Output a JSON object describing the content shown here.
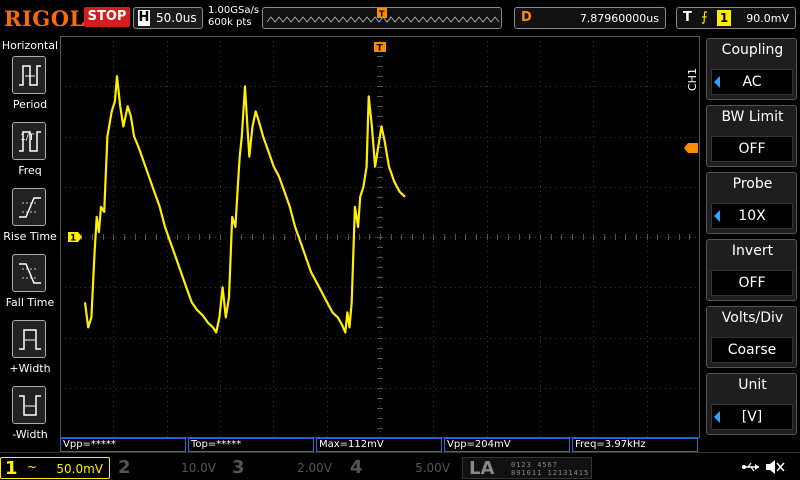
{
  "header": {
    "brand": "RIGOL",
    "run_state": "STOP",
    "horizontal_label": "H",
    "timebase": "50.0us",
    "sample_rate": "1.00GSa/s",
    "memory_depth": "600k pts",
    "delay_label": "D",
    "delay_value": "7.87960000us",
    "trigger_label": "T",
    "trigger_channel": "1",
    "trigger_level": "90.0mV"
  },
  "left_menu": {
    "title": "Horizontal",
    "items": [
      {
        "label": "Period",
        "icon": "period-icon"
      },
      {
        "label": "Freq",
        "icon": "freq-icon"
      },
      {
        "label": "Rise Time",
        "icon": "rise-time-icon"
      },
      {
        "label": "Fall Time",
        "icon": "fall-time-icon"
      },
      {
        "label": "+Width",
        "icon": "pos-width-icon"
      },
      {
        "label": "-Width",
        "icon": "neg-width-icon"
      }
    ]
  },
  "right_menu": {
    "channel_tab": "CH1",
    "items": [
      {
        "title": "Coupling",
        "value": "AC",
        "has_arrow": true
      },
      {
        "title": "BW Limit",
        "value": "OFF",
        "has_arrow": false
      },
      {
        "title": "Probe",
        "value": "10X",
        "has_arrow": true
      },
      {
        "title": "Invert",
        "value": "OFF",
        "has_arrow": false
      },
      {
        "title": "Volts/Div",
        "value": "Coarse",
        "has_arrow": false
      },
      {
        "title": "Unit",
        "value": "[V]",
        "has_arrow": true
      }
    ]
  },
  "measurements": [
    {
      "text": "Vpp=*****"
    },
    {
      "text": "Top=*****"
    },
    {
      "text": "Max=112mV"
    },
    {
      "text": "Vpp=204mV"
    },
    {
      "text": "Freq=3.97kHz"
    }
  ],
  "channels": [
    {
      "num": "1",
      "coupling": "~",
      "scale": "50.0mV",
      "active": true
    },
    {
      "num": "2",
      "coupling": "",
      "scale": "10.0V",
      "active": false
    },
    {
      "num": "3",
      "coupling": "",
      "scale": "2.00V",
      "active": false
    },
    {
      "num": "4",
      "coupling": "",
      "scale": "5.00V",
      "active": false
    }
  ],
  "la": {
    "label": "LA",
    "bits_row1": "0123 4567",
    "bits_row2": "891011 12131415"
  },
  "markers": {
    "trigger_pos": "T",
    "ch1_ground": "1"
  },
  "colors": {
    "ch1": "#ffee00",
    "trigger": "#ff8a00",
    "stop": "#d51d1d",
    "brand": "#ff6a00",
    "grid": "#3a3a3a",
    "menu_accent": "#2fa3ff"
  },
  "waveform": {
    "channel": "1",
    "samples": [
      [
        0.0,
        -1.3
      ],
      [
        0.06,
        -1.8
      ],
      [
        0.12,
        -1.6
      ],
      [
        0.18,
        -0.3
      ],
      [
        0.22,
        0.4
      ],
      [
        0.26,
        0.1
      ],
      [
        0.3,
        0.6
      ],
      [
        0.36,
        0.5
      ],
      [
        0.42,
        2.0
      ],
      [
        0.5,
        2.5
      ],
      [
        0.56,
        2.7
      ],
      [
        0.6,
        3.2
      ],
      [
        0.66,
        2.6
      ],
      [
        0.72,
        2.2
      ],
      [
        0.8,
        2.6
      ],
      [
        0.86,
        2.4
      ],
      [
        0.92,
        2.0
      ],
      [
        1.0,
        1.8
      ],
      [
        1.1,
        1.5
      ],
      [
        1.2,
        1.2
      ],
      [
        1.3,
        0.9
      ],
      [
        1.4,
        0.6
      ],
      [
        1.5,
        0.2
      ],
      [
        1.6,
        -0.1
      ],
      [
        1.7,
        -0.4
      ],
      [
        1.8,
        -0.7
      ],
      [
        1.9,
        -1.0
      ],
      [
        2.0,
        -1.3
      ],
      [
        2.1,
        -1.45
      ],
      [
        2.2,
        -1.55
      ],
      [
        2.3,
        -1.7
      ],
      [
        2.4,
        -1.8
      ],
      [
        2.46,
        -1.9
      ],
      [
        2.52,
        -1.6
      ],
      [
        2.58,
        -1.0
      ],
      [
        2.64,
        -1.6
      ],
      [
        2.7,
        -1.2
      ],
      [
        2.76,
        0.4
      ],
      [
        2.82,
        0.2
      ],
      [
        2.86,
        0.9
      ],
      [
        2.9,
        1.6
      ],
      [
        2.94,
        2.0
      ],
      [
        3.0,
        3.0
      ],
      [
        3.04,
        2.3
      ],
      [
        3.08,
        1.6
      ],
      [
        3.14,
        2.2
      ],
      [
        3.2,
        2.5
      ],
      [
        3.26,
        2.3
      ],
      [
        3.34,
        2.0
      ],
      [
        3.44,
        1.7
      ],
      [
        3.54,
        1.4
      ],
      [
        3.64,
        1.2
      ],
      [
        3.74,
        0.9
      ],
      [
        3.84,
        0.6
      ],
      [
        3.94,
        0.2
      ],
      [
        4.04,
        -0.1
      ],
      [
        4.14,
        -0.4
      ],
      [
        4.24,
        -0.7
      ],
      [
        4.34,
        -0.9
      ],
      [
        4.44,
        -1.1
      ],
      [
        4.54,
        -1.3
      ],
      [
        4.64,
        -1.5
      ],
      [
        4.74,
        -1.6
      ],
      [
        4.82,
        -1.75
      ],
      [
        4.88,
        -1.9
      ],
      [
        4.92,
        -1.5
      ],
      [
        4.96,
        -1.8
      ],
      [
        5.0,
        -1.3
      ],
      [
        5.06,
        0.6
      ],
      [
        5.12,
        0.2
      ],
      [
        5.16,
        0.8
      ],
      [
        5.22,
        1.0
      ],
      [
        5.28,
        1.4
      ],
      [
        5.32,
        2.8
      ],
      [
        5.38,
        2.2
      ],
      [
        5.44,
        1.4
      ],
      [
        5.5,
        1.8
      ],
      [
        5.56,
        2.2
      ],
      [
        5.62,
        1.9
      ],
      [
        5.7,
        1.4
      ],
      [
        5.8,
        1.1
      ],
      [
        5.9,
        0.9
      ],
      [
        6.0,
        0.8
      ]
    ]
  }
}
